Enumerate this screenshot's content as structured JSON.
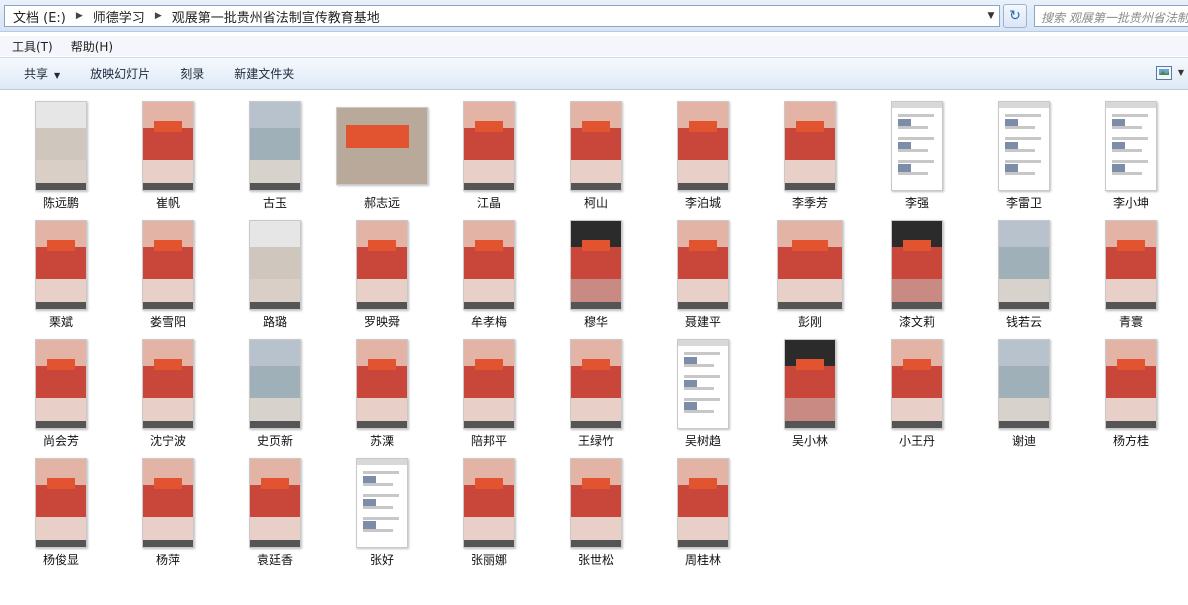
{
  "address": {
    "crumbs": [
      "文档 (E:)",
      "师德学习",
      "观展第一批贵州省法制宣传教育基地"
    ]
  },
  "search": {
    "placeholder": "搜索 观展第一批贵州省法制宣传教育基地"
  },
  "menu": {
    "items": [
      "工具(T)",
      "帮助(H)"
    ]
  },
  "toolbar": {
    "share_label": "共享",
    "slideshow_label": "放映幻灯片",
    "burn_label": "刻录",
    "new_folder_label": "新建文件夹"
  },
  "icons": {
    "refresh": "refresh-icon",
    "chevron": "chevron-down-icon",
    "view": "view-icon",
    "crumb_sep": "chevron-right-icon"
  },
  "colors": {
    "accent": "#2a66b8",
    "banner": "#e2532f",
    "hall_red": "#c8473a"
  },
  "files": [
    {
      "name": "陈远鹏",
      "kind": "plaza"
    },
    {
      "name": "崔帆",
      "kind": "hall"
    },
    {
      "name": "古玉",
      "kind": "corridor"
    },
    {
      "name": "郝志远",
      "kind": "banner"
    },
    {
      "name": "江晶",
      "kind": "hall"
    },
    {
      "name": "柯山",
      "kind": "hall"
    },
    {
      "name": "李泊城",
      "kind": "hall"
    },
    {
      "name": "李季芳",
      "kind": "hall"
    },
    {
      "name": "李强",
      "kind": "doc"
    },
    {
      "name": "李雷卫",
      "kind": "doc"
    },
    {
      "name": "李小坤",
      "kind": "doc"
    },
    {
      "name": "栗斌",
      "kind": "hall"
    },
    {
      "name": "娄雪阳",
      "kind": "hall"
    },
    {
      "name": "路璐",
      "kind": "plaza"
    },
    {
      "name": "罗映舜",
      "kind": "hall"
    },
    {
      "name": "牟孝梅",
      "kind": "hall"
    },
    {
      "name": "穆华",
      "kind": "dark"
    },
    {
      "name": "聂建平",
      "kind": "hall"
    },
    {
      "name": "彭刚",
      "kind": "hall"
    },
    {
      "name": "漆文莉",
      "kind": "dark"
    },
    {
      "name": "钱若云",
      "kind": "corridor"
    },
    {
      "name": "青寰",
      "kind": "hall"
    },
    {
      "name": "尚会芳",
      "kind": "hall"
    },
    {
      "name": "沈宁波",
      "kind": "hall"
    },
    {
      "name": "史页新",
      "kind": "corridor"
    },
    {
      "name": "苏溧",
      "kind": "hall"
    },
    {
      "name": "陪邦平",
      "kind": "hall"
    },
    {
      "name": "王绿竹",
      "kind": "hall"
    },
    {
      "name": "吴树趋",
      "kind": "doc"
    },
    {
      "name": "吴小林",
      "kind": "dark"
    },
    {
      "name": "小王丹",
      "kind": "hall"
    },
    {
      "name": "谢迪",
      "kind": "corridor"
    },
    {
      "name": "杨方桂",
      "kind": "hall"
    },
    {
      "name": "杨俊显",
      "kind": "hall"
    },
    {
      "name": "杨萍",
      "kind": "hall"
    },
    {
      "name": "袁廷香",
      "kind": "hall"
    },
    {
      "name": "张好",
      "kind": "doc"
    },
    {
      "name": "张丽娜",
      "kind": "hall"
    },
    {
      "name": "张世松",
      "kind": "hall"
    },
    {
      "name": "周桂林",
      "kind": "hall"
    }
  ]
}
